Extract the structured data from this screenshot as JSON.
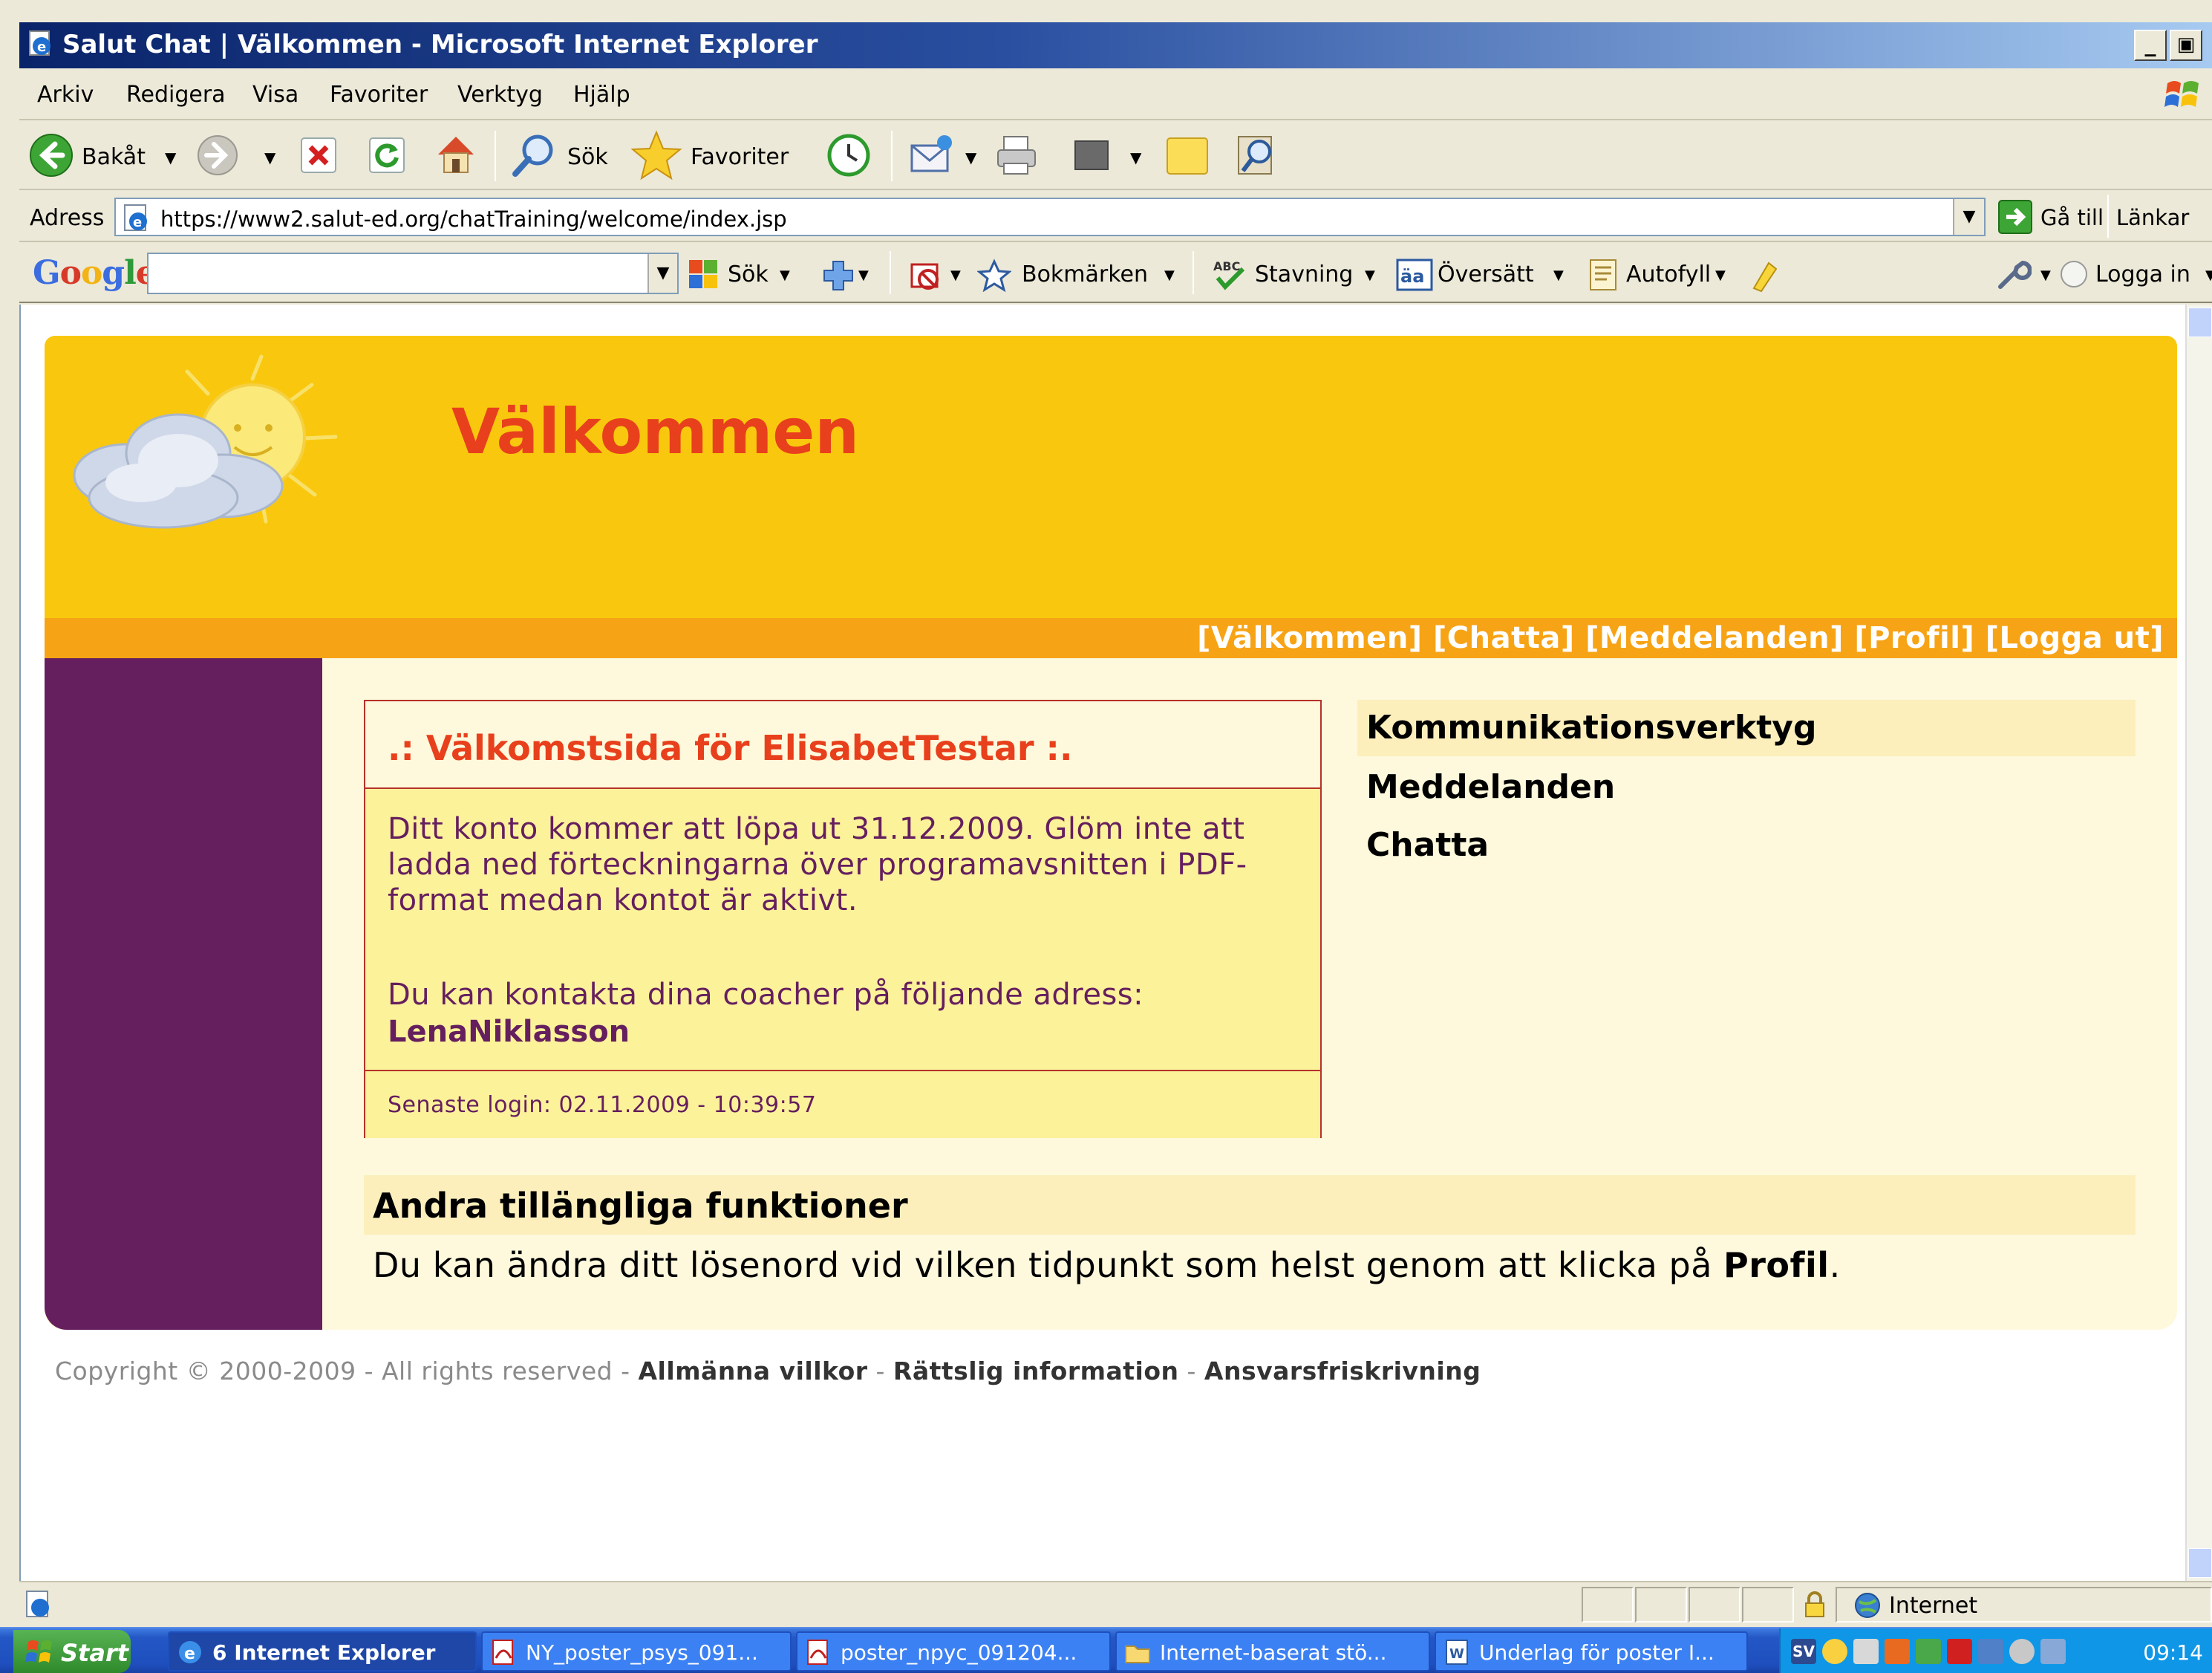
{
  "window": {
    "title": "Salut Chat | Välkommen - Microsoft Internet Explorer",
    "buttons": [
      "_",
      "▣",
      "✕"
    ]
  },
  "menu": [
    "Arkiv",
    "Redigera",
    "Visa",
    "Favoriter",
    "Verktyg",
    "Hjälp"
  ],
  "toolbar": {
    "back": "Bakåt",
    "search": "Sök",
    "favorites": "Favoriter"
  },
  "address": {
    "label": "Adress",
    "url": "https://www2.salut-ed.org/chatTraining/welcome/index.jsp",
    "go": "Gå till",
    "links": "Länkar"
  },
  "google": {
    "logo": "Google",
    "search_value": "",
    "search_btn": "Sök",
    "bookmarks": "Bokmärken",
    "spell": "Stavning",
    "translate": "Översätt",
    "autofill": "Autofyll",
    "login": "Logga in"
  },
  "page": {
    "title": "Välkommen",
    "nav": [
      "[Välkommen]",
      "[Chatta]",
      "[Meddelanden]",
      "[Profil]",
      "[Logga ut]"
    ],
    "welcome_box": {
      "title": ".: Välkomstsida för ElisabetTestar :.",
      "text": "Ditt konto kommer att löpa ut 31.12.2009. Glöm inte att ladda ned förteckningarna över programavsnitten i PDF-format medan kontot är aktivt.",
      "contact": "Du kan kontakta dina coacher på följande adress:",
      "coach": "LenaNiklasson",
      "last_login": "Senaste login: 02.11.2009 - 10:39:57"
    },
    "tools": {
      "heading": "Kommunikationsverktyg",
      "links": [
        "Meddelanden",
        "Chatta"
      ]
    },
    "other": {
      "heading": "Andra tillängliga funktioner",
      "text_prefix": "Du kan ändra ditt lösenord vid vilken tidpunkt som helst genom att klicka på",
      "text_link": "Profil",
      "text_suffix": "."
    },
    "footer": {
      "copyright": "Copyright © 2000-2009 - All rights reserved -",
      "links": [
        "Allmänna villkor",
        "Rättslig information",
        "Ansvarsfriskrivning"
      ],
      "sep": " - "
    }
  },
  "status": {
    "zone": "Internet"
  },
  "taskbar": {
    "start": "Start",
    "tasks": [
      "6 Internet Explorer",
      "NY_poster_psys_091...",
      "poster_npyc_091204...",
      "Internet-baserat stö...",
      "Underlag för poster I..."
    ],
    "clock": "09:14"
  },
  "colors": {
    "header": "#F9C80E",
    "nav_strip": "#F7A316",
    "title": "#E8401C",
    "purple": "#651F5E"
  }
}
